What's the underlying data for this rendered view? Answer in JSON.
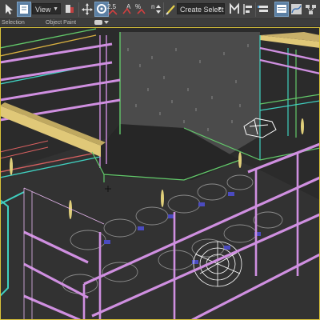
{
  "toolbar": {
    "view_dropdown": "View",
    "selection_set_placeholder": "Create Selection Se",
    "snap_2_5": "2.5",
    "angle_snap": "A",
    "percent_snap": "%",
    "spinner_snap": "n"
  },
  "ribbon": {
    "selection_label": "Selection",
    "object_paint_label": "Object Paint"
  },
  "colors": {
    "toolbar_bg": "#444444",
    "viewport_bg": "#2b2b2b",
    "active_button": "#5b7fa3",
    "railing_magenta": "#cf8fe0",
    "beam_yellow": "#e0c878",
    "wire_cyan": "#3fd0c0",
    "wire_green": "#62c96a",
    "selection_yellow": "#d9c23a",
    "grid_gray": "#bcbcbc"
  }
}
